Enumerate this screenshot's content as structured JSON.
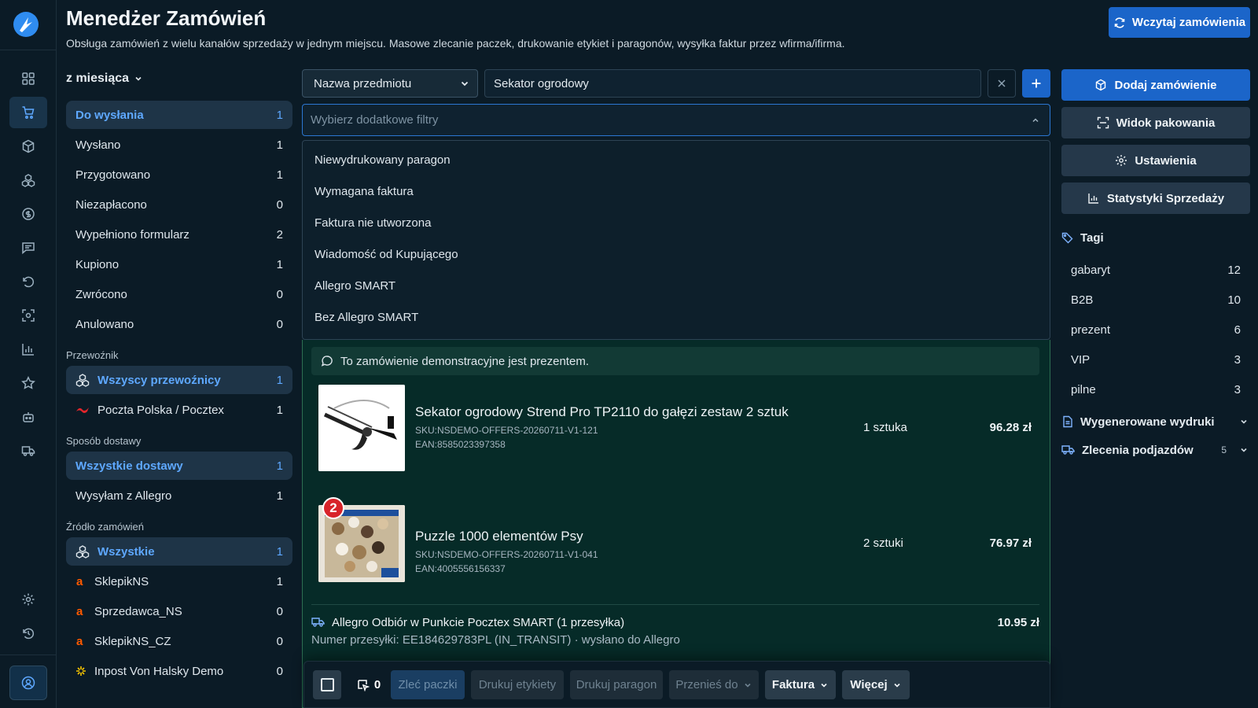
{
  "header": {
    "title": "Menedżer Zamówień",
    "subtitle": "Obsługa zamówień z wielu kanałów sprzedaży w jednym miejscu. Masowe zlecanie paczek, drukowanie etykiet i paragonów, wysyłka faktur przez wfirma/ifirma.",
    "load_button": "Wczytaj zamówienia"
  },
  "period": "z miesiąca",
  "statuses": [
    {
      "label": "Do wysłania",
      "count": "1"
    },
    {
      "label": "Wysłano",
      "count": "1"
    },
    {
      "label": "Przygotowano",
      "count": "1"
    },
    {
      "label": "Niezapłacono",
      "count": "0"
    },
    {
      "label": "Wypełniono formularz",
      "count": "2"
    },
    {
      "label": "Kupiono",
      "count": "1"
    },
    {
      "label": "Zwrócono",
      "count": "0"
    },
    {
      "label": "Anulowano",
      "count": "0"
    }
  ],
  "carriers": {
    "heading": "Przewoźnik",
    "items": [
      {
        "label": "Wszyscy przewoźnicy",
        "count": "1"
      },
      {
        "label": "Poczta Polska / Pocztex",
        "count": "1"
      }
    ]
  },
  "delivery": {
    "heading": "Sposób dostawy",
    "items": [
      {
        "label": "Wszystkie dostawy",
        "count": "1"
      },
      {
        "label": "Wysyłam z Allegro",
        "count": "1"
      }
    ]
  },
  "sources": {
    "heading": "Źródło zamówień",
    "items": [
      {
        "label": "Wszystkie",
        "count": "1"
      },
      {
        "label": "SklepikNS",
        "count": "1"
      },
      {
        "label": "Sprzedawca_NS",
        "count": "0"
      },
      {
        "label": "SklepikNS_CZ",
        "count": "0"
      },
      {
        "label": "Inpost Von Halsky Demo",
        "count": "0"
      }
    ]
  },
  "filter": {
    "field": "Nazwa przedmiotu",
    "value": "Sekator ogrodowy",
    "extra_placeholder": "Wybierz dodatkowe filtry",
    "options": [
      "Niewydrukowany paragon",
      "Wymagana faktura",
      "Faktura nie utworzona",
      "Wiadomość od Kupującego",
      "Allegro SMART",
      "Bez Allegro SMART"
    ]
  },
  "order": {
    "note": "To zamówienie demonstracyjne jest prezentem.",
    "products": [
      {
        "name": "Sekator ogrodowy Strend Pro TP2110 do gałęzi zestaw 2 sztuk",
        "sku": "SKU:NSDEMO-OFFERS-20260711-V1-121",
        "ean": "EAN:8585023397358",
        "qty": "1 sztuka",
        "price": "96.28 zł",
        "badge": ""
      },
      {
        "name": "Puzzle 1000 elementów Psy",
        "sku": "SKU:NSDEMO-OFFERS-20260711-V1-041",
        "ean": "EAN:4005556156337",
        "qty": "2 sztuki",
        "price": "76.97 zł",
        "badge": "2"
      }
    ],
    "shipping": {
      "method": "Allegro Odbiór w Punkcie Pocztex SMART (1 przesyłka)",
      "price": "10.95 zł",
      "tracking": "Numer przesyłki: EE184629783PL (IN_TRANSIT) · wysłano do Allegro"
    }
  },
  "actions": {
    "selected_count": "0",
    "zlec": "Zleć paczki",
    "print_labels": "Drukuj etykiety",
    "print_receipt": "Drukuj paragon",
    "move_to": "Przenieś do",
    "invoice": "Faktura",
    "more": "Więcej"
  },
  "right": {
    "add_order": "Dodaj zamówienie",
    "packing_view": "Widok pakowania",
    "settings": "Ustawienia",
    "stats": "Statystyki Sprzedaży",
    "tags_heading": "Tagi",
    "tags": [
      {
        "label": "gabaryt",
        "count": "12"
      },
      {
        "label": "B2B",
        "count": "10"
      },
      {
        "label": "prezent",
        "count": "6"
      },
      {
        "label": "VIP",
        "count": "3"
      },
      {
        "label": "pilne",
        "count": "3"
      }
    ],
    "printouts": "Wygenerowane wydruki",
    "pickups": "Zlecenia podjazdów",
    "pickups_count": "5"
  },
  "colors": {
    "accent": "#1b65c9",
    "selected_text": "#5ea8ff",
    "card_bg": "#062b28",
    "allegro_orange": "#ff5a00"
  }
}
